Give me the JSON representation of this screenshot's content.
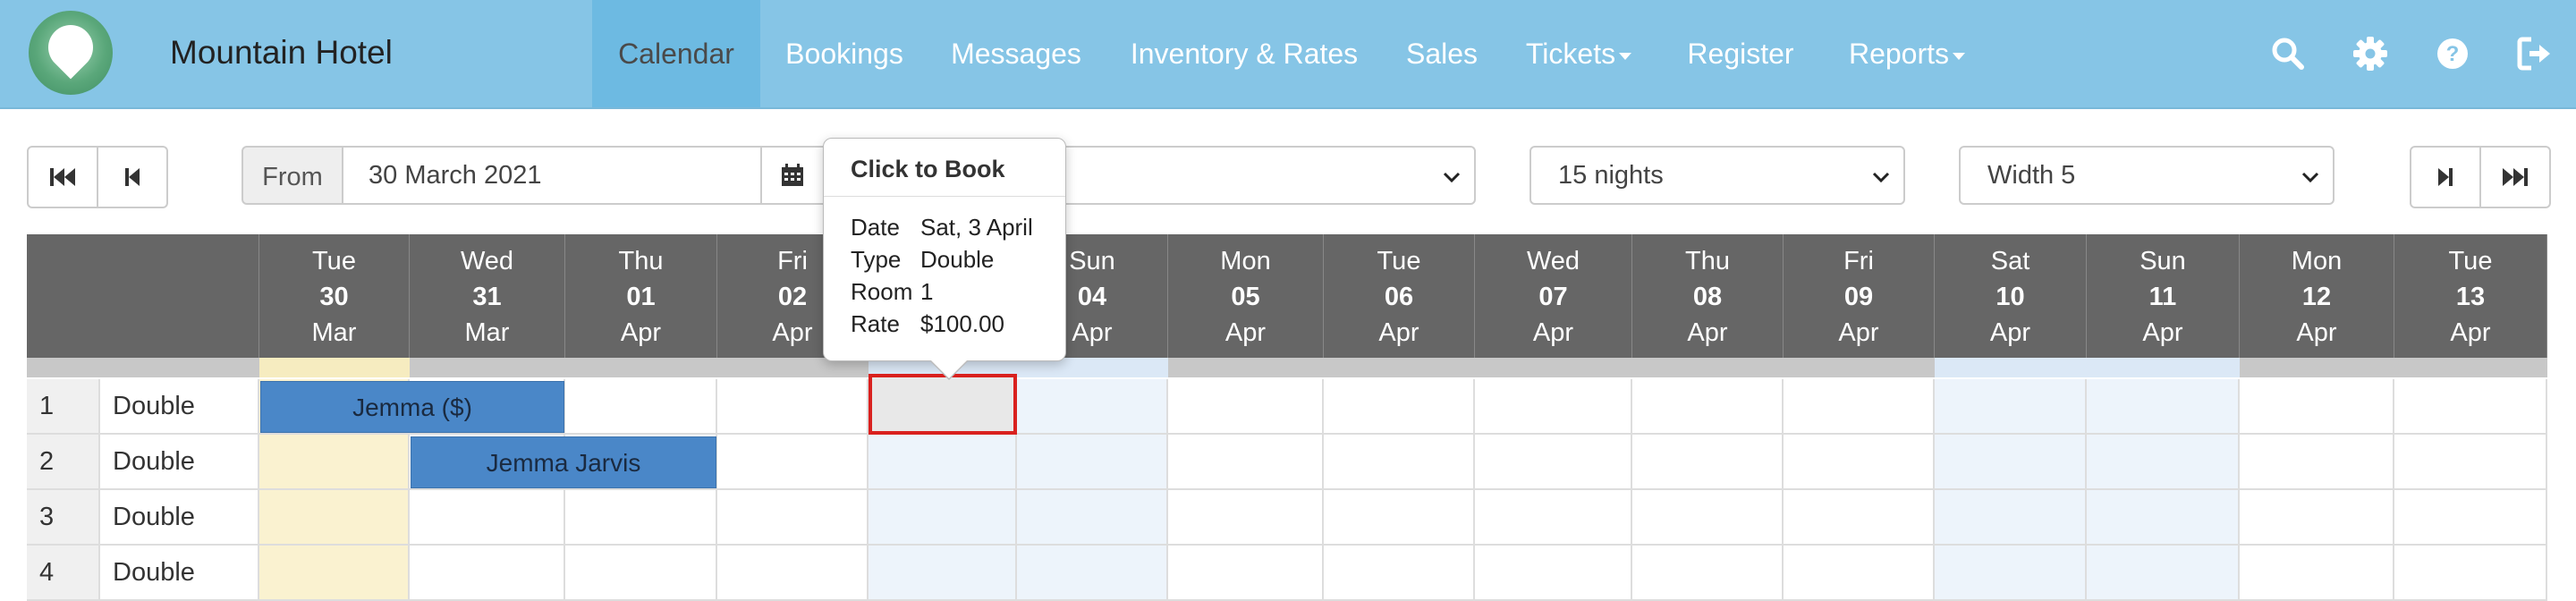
{
  "brand": "Mountain Hotel",
  "nav": [
    {
      "label": "Calendar",
      "active": true
    },
    {
      "label": "Bookings"
    },
    {
      "label": "Messages"
    },
    {
      "label": "Inventory & Rates"
    },
    {
      "label": "Sales"
    },
    {
      "label": "Tickets",
      "dropdown": true
    },
    {
      "label": "Register"
    },
    {
      "label": "Reports",
      "dropdown": true
    }
  ],
  "nav_icons": [
    "search-icon",
    "gear-icon",
    "help-icon",
    "logout-icon"
  ],
  "toolbar": {
    "from_label": "From",
    "from_value": "30 March 2021",
    "nights": "15 nights",
    "width": "Width 5"
  },
  "days": [
    {
      "dow": "Tue",
      "num": "30",
      "mon": "Mar"
    },
    {
      "dow": "Wed",
      "num": "31",
      "mon": "Mar"
    },
    {
      "dow": "Thu",
      "num": "01",
      "mon": "Apr"
    },
    {
      "dow": "Fri",
      "num": "02",
      "mon": "Apr"
    },
    {
      "dow": "Sat",
      "num": "03",
      "mon": "Apr"
    },
    {
      "dow": "Sun",
      "num": "04",
      "mon": "Apr"
    },
    {
      "dow": "Mon",
      "num": "05",
      "mon": "Apr"
    },
    {
      "dow": "Tue",
      "num": "06",
      "mon": "Apr"
    },
    {
      "dow": "Wed",
      "num": "07",
      "mon": "Apr"
    },
    {
      "dow": "Thu",
      "num": "08",
      "mon": "Apr"
    },
    {
      "dow": "Fri",
      "num": "09",
      "mon": "Apr"
    },
    {
      "dow": "Sat",
      "num": "10",
      "mon": "Apr"
    },
    {
      "dow": "Sun",
      "num": "11",
      "mon": "Apr"
    },
    {
      "dow": "Mon",
      "num": "12",
      "mon": "Apr"
    },
    {
      "dow": "Tue",
      "num": "13",
      "mon": "Apr"
    }
  ],
  "rooms": [
    {
      "num": "1",
      "type": "Double"
    },
    {
      "num": "2",
      "type": "Double"
    },
    {
      "num": "3",
      "type": "Double"
    },
    {
      "num": "4",
      "type": "Double"
    }
  ],
  "bookings": [
    {
      "label": "Jemma ($)",
      "room": "1",
      "start": "30 Mar",
      "nights": 2
    },
    {
      "label": "Jemma Jarvis",
      "room": "2",
      "start": "31 Mar",
      "nights": 2
    }
  ],
  "tooltip": {
    "title": "Click to Book",
    "rows": [
      {
        "k": "Date",
        "v": "Sat, 3 April"
      },
      {
        "k": "Type",
        "v": "Double"
      },
      {
        "k": "Room",
        "v": "1"
      },
      {
        "k": "Rate",
        "v": "$100.00"
      }
    ]
  },
  "colors": {
    "navbar": "#86c5e6",
    "header": "#666666",
    "booking": "#4a87c8",
    "today": "#faf2d0",
    "weekend": "#edf4fb",
    "selection": "#d9211f"
  }
}
